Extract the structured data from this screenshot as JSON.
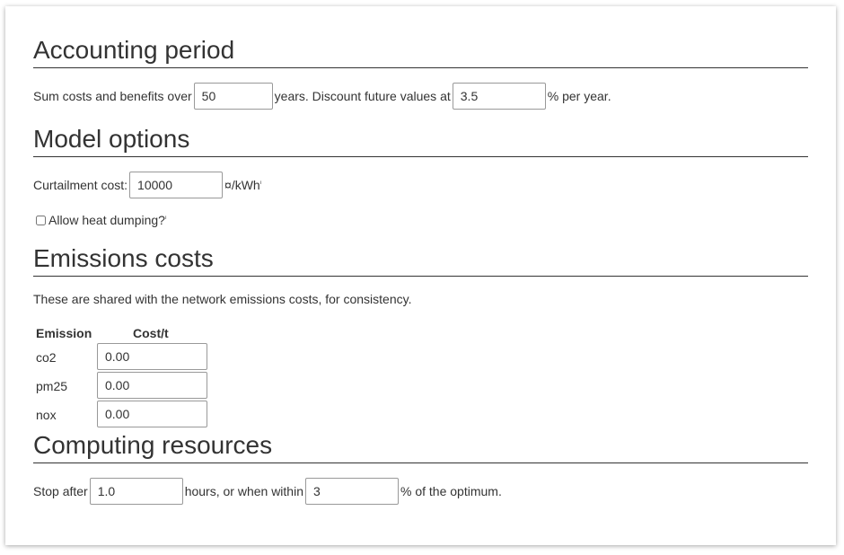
{
  "accounting": {
    "title": "Accounting period",
    "sum_label": "Sum costs and benefits over",
    "years_value": "50",
    "discount_label": "years. Discount future values at",
    "discount_value": "3.5",
    "per_year_label": "% per year."
  },
  "model": {
    "title": "Model options",
    "curtailment_label": "Curtailment cost:",
    "curtailment_value": "10000",
    "curtailment_unit": "¤/kWh",
    "heat_dumping_label": "Allow heat dumping?",
    "heat_dumping_checked": false,
    "help_mark": "ⁱ"
  },
  "emissions": {
    "title": "Emissions costs",
    "description": "These are shared with the network emissions costs, for consistency.",
    "col_emission": "Emission",
    "col_cost": "Cost/t",
    "rows": [
      {
        "name": "co2",
        "value": "0.00"
      },
      {
        "name": "pm25",
        "value": "0.00"
      },
      {
        "name": "nox",
        "value": "0.00"
      }
    ]
  },
  "computing": {
    "title": "Computing resources",
    "stop_label": "Stop after",
    "hours_value": "1.0",
    "hours_label": "hours, or when within",
    "within_value": "3",
    "optimum_label": "% of the optimum."
  }
}
